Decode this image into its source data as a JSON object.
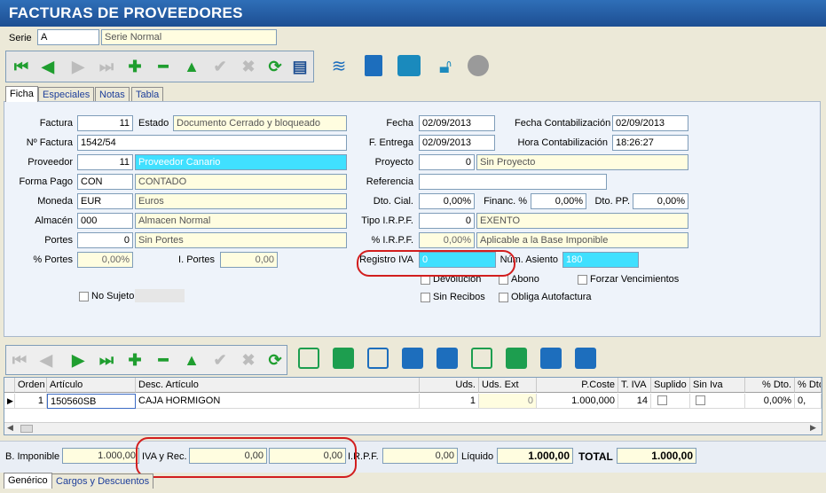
{
  "window": {
    "title": "FACTURAS DE PROVEEDORES"
  },
  "serie": {
    "label": "Serie",
    "code": "A",
    "name": "Serie Normal"
  },
  "tabs": [
    {
      "label": "Ficha"
    },
    {
      "label": "Especiales"
    },
    {
      "label": "Notas"
    },
    {
      "label": "Tabla"
    }
  ],
  "form": {
    "factura": {
      "label": "Factura",
      "value": "11"
    },
    "estado": {
      "label": "Estado",
      "value": "Documento Cerrado y bloqueado"
    },
    "num_factura": {
      "label": "Nº Factura",
      "value": "1542/54"
    },
    "proveedor": {
      "label": "Proveedor",
      "code": "11",
      "name": "Proveedor Canario"
    },
    "forma_pago": {
      "label": "Forma Pago",
      "code": "CON",
      "name": "CONTADO"
    },
    "moneda": {
      "label": "Moneda",
      "code": "EUR",
      "name": "Euros"
    },
    "almacen": {
      "label": "Almacén",
      "code": "000",
      "name": "Almacen Normal"
    },
    "portes": {
      "label": "Portes",
      "code": "0",
      "name": "Sin Portes"
    },
    "pct_portes": {
      "label": "% Portes",
      "value": "0,00%"
    },
    "i_portes": {
      "label": "I. Portes",
      "value": "0,00"
    },
    "no_sujeto": {
      "label": "No Sujeto"
    },
    "fecha": {
      "label": "Fecha",
      "value": "02/09/2013"
    },
    "f_entrega": {
      "label": "F. Entrega",
      "value": "02/09/2013"
    },
    "proyecto": {
      "label": "Proyecto",
      "code": "0",
      "name": "Sin Proyecto"
    },
    "referencia": {
      "label": "Referencia",
      "value": ""
    },
    "dto_cial": {
      "label": "Dto. Cial.",
      "value": "0,00%"
    },
    "financ": {
      "label": "Financ. %",
      "value": "0,00%"
    },
    "dto_pp": {
      "label": "Dto. PP.",
      "value": "0,00%"
    },
    "tipo_irpf": {
      "label": "Tipo I.R.P.F.",
      "code": "0",
      "name": "EXENTO"
    },
    "pct_irpf": {
      "label": "% I.R.P.F.",
      "value": "0,00%",
      "name": "Aplicable a la Base Imponible"
    },
    "registro_iva": {
      "label": "Registro IVA",
      "value": "0"
    },
    "num_asiento": {
      "label": "Núm. Asiento",
      "value": "180"
    },
    "fecha_contab": {
      "label": "Fecha Contabilización",
      "value": "02/09/2013"
    },
    "hora_contab": {
      "label": "Hora Contabilización",
      "value": "18:26:27"
    },
    "devolucion": {
      "label": "Devolucion"
    },
    "abono": {
      "label": "Abono"
    },
    "forzar": {
      "label": "Forzar Vencimientos"
    },
    "sin_recibos": {
      "label": "Sin Recibos"
    },
    "obliga": {
      "label": "Obliga Autofactura"
    }
  },
  "grid": {
    "columns": [
      "Orden",
      "Artículo",
      "Desc. Artículo",
      "Uds.",
      "Uds. Ext",
      "P.Coste",
      "T. IVA",
      "Suplido",
      "Sin Iva",
      "% Dto.",
      "% Dto"
    ],
    "rows": [
      {
        "orden": "1",
        "articulo": "150560SB",
        "desc": "CAJA HORMIGON",
        "uds": "1",
        "uds_ext": "0",
        "pcoste": "1.000,000",
        "tiva": "14",
        "dto": "0,00%",
        "dto2": "0,"
      }
    ]
  },
  "totals": {
    "b_imponible": {
      "label": "B. Imponible",
      "value": "1.000,00"
    },
    "iva_rec": {
      "label": "IVA y Rec.",
      "iva": "0,00",
      "rec": "0,00"
    },
    "irpf": {
      "label": "I.R.P.F.",
      "value": "0,00"
    },
    "liquido": {
      "label": "Líquido",
      "value": "1.000,00"
    },
    "total": {
      "label": "TOTAL",
      "value": "1.000,00"
    }
  },
  "bottom_tabs": [
    {
      "label": "Genérico"
    },
    {
      "label": "Cargos y Descuentos"
    }
  ]
}
